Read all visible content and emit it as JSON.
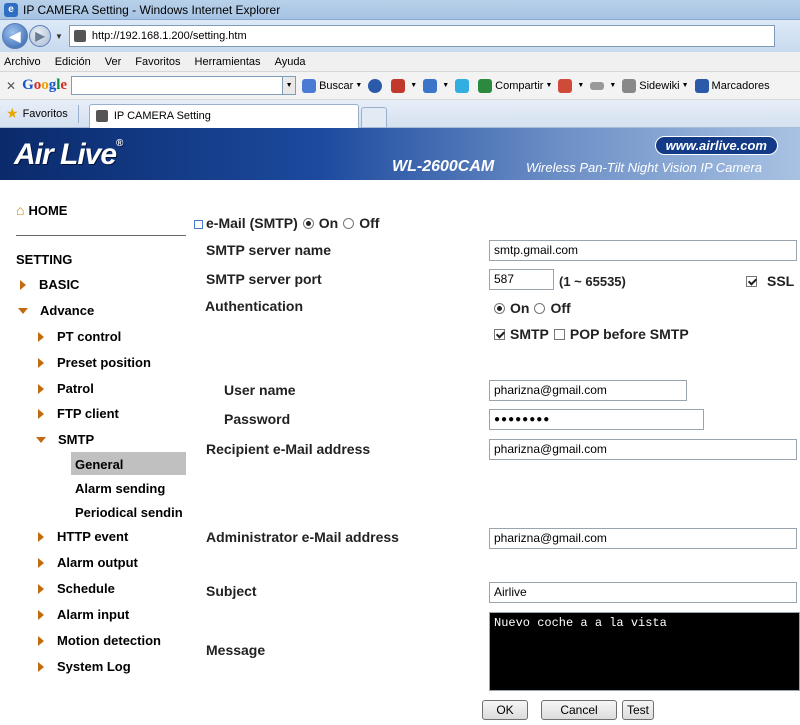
{
  "browser": {
    "window_title": "IP CAMERA Setting - Windows Internet Explorer",
    "url": "http://192.168.1.200/setting.htm",
    "menu": [
      "Archivo",
      "Edición",
      "Ver",
      "Favoritos",
      "Herramientas",
      "Ayuda"
    ],
    "google_toolbar": {
      "close": "✕",
      "logo_letters": [
        "G",
        "o",
        "o",
        "g",
        "l",
        "e"
      ],
      "buscar": "Buscar",
      "compartir": "Compartir",
      "sidewiki": "Sidewiki",
      "marcadores": "Marcadores"
    },
    "favorites_label": "Favoritos",
    "tab_title": "IP CAMERA Setting"
  },
  "banner": {
    "logo": "Air Live",
    "logo_mark": "®",
    "website": "www.airlive.com",
    "model": "WL-2600CAM",
    "description": "Wireless Pan-Tilt Night Vision IP Camera"
  },
  "sidebar": {
    "home": "HOME",
    "setting": "SETTING",
    "basic": "BASIC",
    "advance": "Advance",
    "advance_items": [
      "PT control",
      "Preset position",
      "Patrol",
      "FTP client"
    ],
    "smtp": "SMTP",
    "smtp_items": [
      "General",
      "Alarm sending",
      "Periodical sendin"
    ],
    "other_items": [
      "HTTP event",
      "Alarm output",
      "Schedule",
      "Alarm input",
      "Motion detection",
      "System Log"
    ]
  },
  "form": {
    "email_smtp_label": "e-Mail (SMTP)",
    "email_on": "On",
    "email_off": "Off",
    "smtp_server_name_label": "SMTP server name",
    "smtp_server_name_value": "smtp.gmail.com",
    "smtp_server_port_label": "SMTP server port",
    "smtp_server_port_value": "587",
    "port_range": "(1 ~ 65535)",
    "ssl_label": "SSL",
    "authentication_label": "Authentication",
    "auth_on": "On",
    "auth_off": "Off",
    "auth_smtp": "SMTP",
    "auth_pop": "POP before SMTP",
    "username_label": "User name",
    "username_value": "pharizna@gmail.com",
    "password_label": "Password",
    "password_value": "●●●●●●●●",
    "recipient_label": "Recipient e-Mail address",
    "recipient_value": "pharizna@gmail.com",
    "admin_label": "Administrator e-Mail address",
    "admin_value": "pharizna@gmail.com",
    "subject_label": "Subject",
    "subject_value": "Airlive",
    "message_label": "Message",
    "message_value": "Nuevo coche a a la vista",
    "ok_button": "OK",
    "cancel_button": "Cancel",
    "test_button": "Test"
  }
}
